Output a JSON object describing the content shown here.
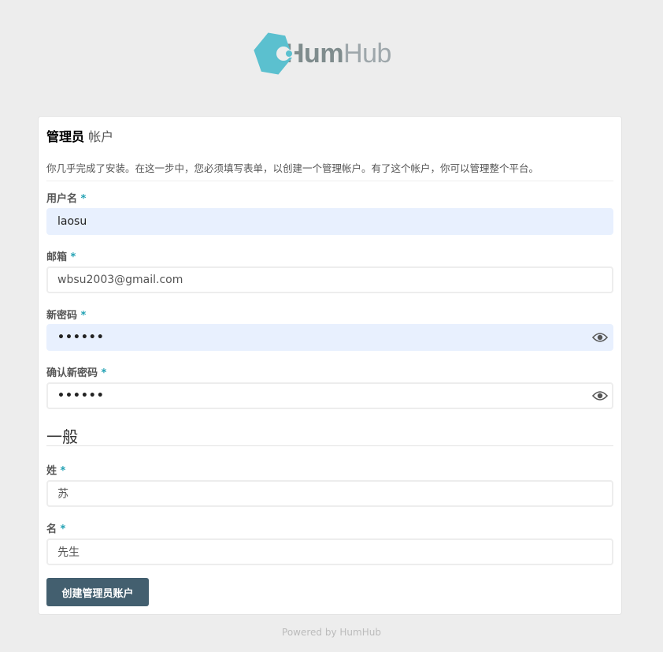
{
  "logo": {
    "part1": "Hum",
    "part2": "Hub"
  },
  "panel": {
    "title_strong": "管理员",
    "title_rest": "帐户",
    "intro": "你几乎完成了安装。在这一步中，您必须填写表单，以创建一个管理帐户。有了这个帐户，你可以管理整个平台。"
  },
  "fields": {
    "username": {
      "label": "用户名",
      "value": "laosu"
    },
    "email": {
      "label": "邮箱",
      "value": "wbsu2003@gmail.com"
    },
    "password": {
      "label": "新密码",
      "value": "••••••"
    },
    "confirm": {
      "label": "确认新密码",
      "value": "••••••"
    },
    "lastname": {
      "label": "姓",
      "value": "苏"
    },
    "firstname": {
      "label": "名",
      "value": "先生"
    }
  },
  "required_mark": "*",
  "general_section": "一般",
  "submit_label": "创建管理员账户",
  "footer": "Powered by HumHub",
  "colors": {
    "accent": "#21a1b3",
    "button": "#435f6f",
    "logo": "#5bc0cf"
  },
  "icons": {
    "show_password": "eye-icon"
  }
}
